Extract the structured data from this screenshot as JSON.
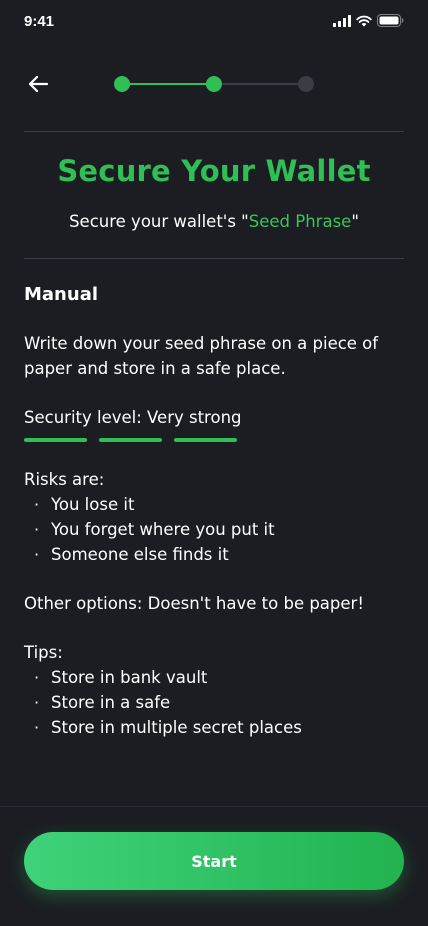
{
  "status_bar": {
    "time": "9:41",
    "icons": [
      "signal-icon",
      "wifi-icon",
      "battery-icon"
    ]
  },
  "nav": {
    "back_icon": "arrow-left-icon",
    "progress_steps": [
      {
        "state": "complete"
      },
      {
        "state": "current"
      },
      {
        "state": "pending"
      }
    ]
  },
  "header": {
    "title": "Secure Your Wallet",
    "subtitle_prefix": "Secure your wallet's \"",
    "subtitle_highlight": "Seed Phrase",
    "subtitle_suffix": "\""
  },
  "manual": {
    "heading": "Manual",
    "description": "Write down your seed phrase on a piece of paper and store in a safe place.",
    "security_level": "Security level: Very strong",
    "security_bars_filled": 3,
    "security_bars_total": 3,
    "risks_heading": "Risks are:",
    "risks": [
      "You lose it",
      "You forget where you put it",
      "Someone else finds it"
    ],
    "other_options": "Other options: Doesn't have to be paper!",
    "tips_heading": "Tips:",
    "tips": [
      "Store in bank vault",
      "Store in a safe",
      "Store in multiple secret places"
    ],
    "bullet_char": "·"
  },
  "footer": {
    "start_label": "Start"
  },
  "colors": {
    "background": "#1b1d22",
    "accent": "#2fbf55",
    "pending_step": "#3a3d44",
    "divider": "#3a3d44"
  }
}
